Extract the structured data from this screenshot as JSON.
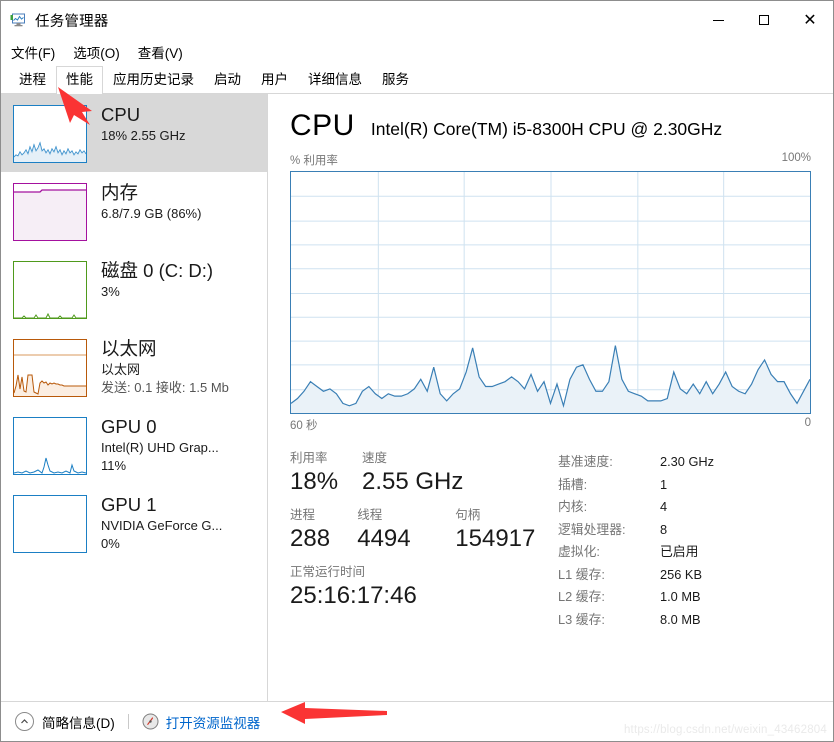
{
  "window": {
    "title": "任务管理器",
    "icon": "task-manager-icon",
    "minimize": "—",
    "maximize": "□",
    "close": "✕"
  },
  "menu": [
    {
      "label": "文件(F)"
    },
    {
      "label": "选项(O)"
    },
    {
      "label": "查看(V)"
    }
  ],
  "tabs": [
    {
      "label": "进程",
      "active": false
    },
    {
      "label": "性能",
      "active": true
    },
    {
      "label": "应用历史记录",
      "active": false
    },
    {
      "label": "启动",
      "active": false
    },
    {
      "label": "用户",
      "active": false
    },
    {
      "label": "详细信息",
      "active": false
    },
    {
      "label": "服务",
      "active": false
    }
  ],
  "sidebar": {
    "items": [
      {
        "title": "CPU",
        "sub1": "18% 2.55 GHz",
        "sub2": "",
        "sub3": "",
        "selected": true,
        "color": "#1b7fc4",
        "fill": "#eaf3fa"
      },
      {
        "title": "内存",
        "sub1": "6.8/7.9 GB (86%)",
        "sub2": "",
        "sub3": "",
        "selected": false,
        "color": "#a4119e",
        "fill": "#f6eef6"
      },
      {
        "title": "磁盘 0 (C: D:)",
        "sub1": "3%",
        "sub2": "",
        "sub3": "",
        "selected": false,
        "color": "#4f9a1c",
        "fill": "#f0f7e9"
      },
      {
        "title": "以太网",
        "sub1": "以太网",
        "sub2": "发送: 0.1 接收: 1.5 Mb",
        "sub3": "",
        "selected": false,
        "color": "#b8590a",
        "fill": "#fbeee2"
      },
      {
        "title": "GPU 0",
        "sub1": "Intel(R) UHD Grap...",
        "sub2": "11%",
        "sub3": "",
        "selected": false,
        "color": "#1b7fc4",
        "fill": "#eaf3fa"
      },
      {
        "title": "GPU 1",
        "sub1": "NVIDIA GeForce G...",
        "sub2": "0%",
        "sub3": "",
        "selected": false,
        "color": "#1b7fc4",
        "fill": "#eaf3fa"
      }
    ]
  },
  "main": {
    "title": "CPU",
    "model": "Intel(R) Core(TM) i5-8300H CPU @ 2.30GHz",
    "chart_top_left": "% 利用率",
    "chart_top_right": "100%",
    "chart_bottom_left": "60 秒",
    "chart_bottom_right": "0",
    "stats": {
      "utilization_label": "利用率",
      "utilization_value": "18%",
      "speed_label": "速度",
      "speed_value": "2.55 GHz",
      "processes_label": "进程",
      "processes_value": "288",
      "threads_label": "线程",
      "threads_value": "4494",
      "handles_label": "句柄",
      "handles_value": "154917",
      "uptime_label": "正常运行时间",
      "uptime_value": "25:16:17:46"
    },
    "specs": [
      {
        "label": "基准速度:",
        "value": "2.30 GHz"
      },
      {
        "label": "插槽:",
        "value": "1"
      },
      {
        "label": "内核:",
        "value": "4"
      },
      {
        "label": "逻辑处理器:",
        "value": "8"
      },
      {
        "label": "虚拟化:",
        "value": "已启用"
      },
      {
        "label": "L1 缓存:",
        "value": "256 KB"
      },
      {
        "label": "L2 缓存:",
        "value": "1.0 MB"
      },
      {
        "label": "L3 缓存:",
        "value": "8.0 MB"
      }
    ]
  },
  "statusbar": {
    "fewer_details": "简略信息(D)",
    "resource_monitor": "打开资源监视器",
    "watermark": "https://blog.csdn.net/weixin_43462804"
  },
  "colors": {
    "cpu_line": "#3a7fb5",
    "cpu_fill": "#eaf2f8",
    "grid": "#cfe2f0",
    "accent_link": "#0066cc",
    "annotation_arrow": "#fa3434",
    "selected_bg": "#d8d8d8"
  },
  "chart_data": {
    "type": "area",
    "title": "% 利用率",
    "xlabel": "60 秒",
    "ylabel": "% 利用率",
    "ylim": [
      0,
      100
    ],
    "xlim": [
      60,
      0
    ],
    "grid": true,
    "grid_cols": 6,
    "grid_rows": 10,
    "series": [
      {
        "name": "CPU 利用率",
        "values": [
          4,
          6,
          9,
          13,
          11,
          9,
          10,
          8,
          4,
          3,
          4,
          9,
          11,
          8,
          6,
          8,
          7,
          7,
          8,
          10,
          14,
          9,
          19,
          8,
          5,
          8,
          10,
          17,
          27,
          15,
          11,
          11,
          12,
          13,
          15,
          13,
          10,
          16,
          9,
          13,
          4,
          12,
          3,
          14,
          19,
          20,
          14,
          9,
          9,
          13,
          28,
          14,
          9,
          8,
          7,
          5,
          5,
          5,
          6,
          17,
          10,
          8,
          12,
          8,
          13,
          8,
          12,
          17,
          11,
          9,
          8,
          12,
          18,
          22,
          16,
          13,
          13,
          8,
          4,
          9,
          14
        ]
      }
    ]
  }
}
